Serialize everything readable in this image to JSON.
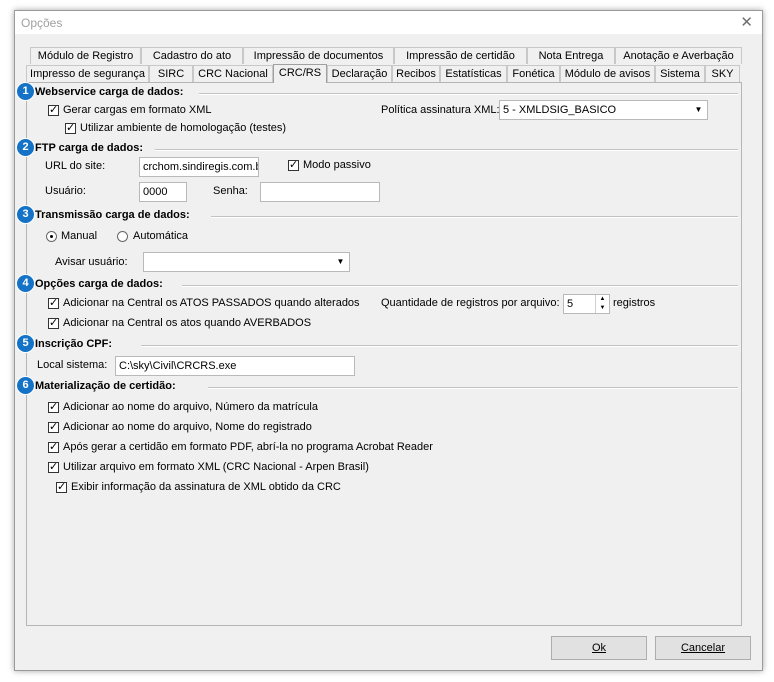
{
  "window": {
    "title": "Opções",
    "close_glyph": "✕"
  },
  "tabs_row1": [
    "Módulo de Registro",
    "Cadastro do ato",
    "Impressão de documentos",
    "Impressão de certidão",
    "Nota Entrega",
    "Anotação e Averbação"
  ],
  "tabs_row2": [
    "Impresso de segurança",
    "SIRC",
    "CRC Nacional",
    "CRC/RS",
    "Declaração",
    "Recibos",
    "Estatísticas",
    "Fonética",
    "Módulo de avisos",
    "Sistema",
    "SKY"
  ],
  "active_tab": "CRC/RS",
  "accent_color": "#1473c6",
  "sections": {
    "webservice": {
      "badge": "1",
      "title": "Webservice carga de dados:",
      "gerar_xml": {
        "label": "Gerar cargas em formato XML",
        "checked": true
      },
      "homologacao": {
        "label": "Utilizar ambiente de homologação (testes)",
        "checked": true
      },
      "politica_label": "Política assinatura XML:",
      "politica_value": "5 - XMLDSIG_BASICO"
    },
    "ftp": {
      "badge": "2",
      "title": "FTP carga de dados:",
      "url_label": "URL do site:",
      "url_value": "crchom.sindiregis.com.b",
      "modo_passivo": {
        "label": "Modo passivo",
        "checked": true
      },
      "usuario_label": "Usuário:",
      "usuario_value": "0000",
      "senha_label": "Senha:",
      "senha_value": ""
    },
    "transmissao": {
      "badge": "3",
      "title": "Transmissão carga de dados:",
      "manual": {
        "label": "Manual",
        "selected": true
      },
      "automatica": {
        "label": "Automática",
        "selected": false
      },
      "avisar_label": "Avisar usuário:",
      "avisar_value": ""
    },
    "opcoes": {
      "badge": "4",
      "title": "Opções carga de dados:",
      "atos_passados": {
        "label": "Adicionar na Central os ATOS PASSADOS quando alterados",
        "checked": true
      },
      "averbados": {
        "label": "Adicionar na Central os atos quando AVERBADOS",
        "checked": true
      },
      "qtd_label": "Quantidade de registros por arquivo:",
      "qtd_value": "5",
      "qtd_suffix": "registros"
    },
    "cpf": {
      "badge": "5",
      "title": "Inscrição CPF:",
      "local_label": "Local sistema:",
      "local_value": "C:\\sky\\Civil\\CRCRS.exe"
    },
    "materializacao": {
      "badge": "6",
      "title": "Materialização de certidão:",
      "items": [
        {
          "label": "Adicionar ao nome do arquivo, Número da matrícula",
          "checked": true
        },
        {
          "label": "Adicionar ao nome do arquivo, Nome do registrado",
          "checked": true
        },
        {
          "label": "Após gerar a certidão em formato PDF, abrí-la no programa Acrobat Reader",
          "checked": true
        },
        {
          "label": "Utilizar arquivo em formato XML (CRC Nacional - Arpen Brasil)",
          "checked": true
        },
        {
          "label": "Exibir informação da assinatura de XML obtido da CRC",
          "checked": true
        }
      ]
    }
  },
  "buttons": {
    "ok": "Ok",
    "cancel": "Cancelar"
  }
}
